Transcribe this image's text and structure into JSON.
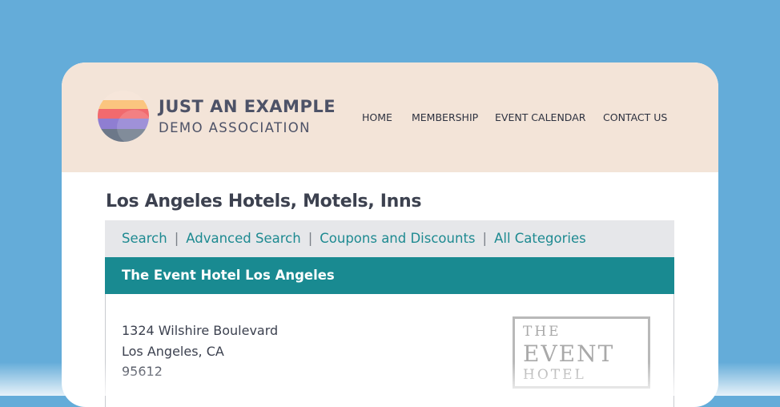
{
  "brand": {
    "title": "JUST AN EXAMPLE",
    "subtitle": "DEMO ASSOCIATION"
  },
  "nav": {
    "items": [
      "HOME",
      "MEMBERSHIP",
      "EVENT CALENDAR",
      "CONTACT US"
    ]
  },
  "page": {
    "title": "Los Angeles Hotels, Motels, Inns"
  },
  "subnav": {
    "items": [
      "Search",
      "Advanced Search",
      "Coupons and Discounts",
      "All Categories"
    ],
    "separator": "|"
  },
  "listing": {
    "name": "The Event Hotel Los Angeles",
    "address": [
      "1324 Wilshire Boulevard",
      "Los Angeles, CA",
      "95612"
    ],
    "logo_text": [
      "THE",
      "EVENT",
      "HOTEL"
    ]
  },
  "colors": {
    "background": "#64acd9",
    "header": "#f3e4d8",
    "accent_teal": "#198a91",
    "link_teal": "#1e8a91",
    "subnav_bg": "#e6e7ea"
  },
  "icons": {
    "logo": "sunset-stripes-circle-icon"
  }
}
